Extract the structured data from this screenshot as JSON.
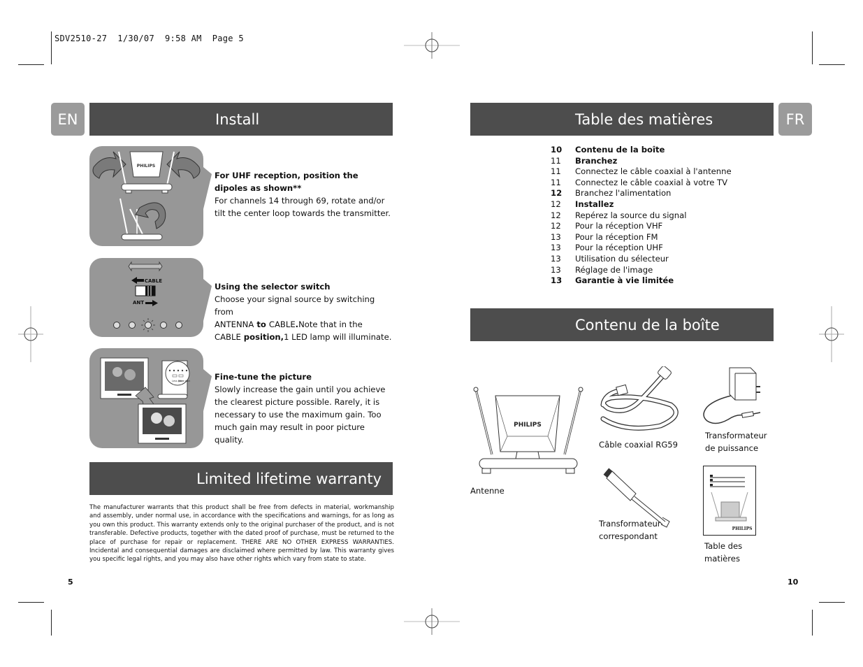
{
  "slug": "SDV2510-27  1/30/07  9:58 AM  Page 5",
  "left_page": {
    "lang_tab": "EN",
    "section_title": "Install",
    "steps": [
      {
        "title": "For UHF reception, position the dipoles as shown**",
        "body": "For channels 14 through 69, rotate and/or tilt the center loop towards the transmitter.",
        "illustration": "antenna-rotation-illustration"
      },
      {
        "title": "Using the selector switch",
        "body_parts": [
          "Choose your signal source by switching from ",
          "ANTENNA",
          " to ",
          "CABLE",
          ".",
          "Note that in the ",
          "CABLE",
          " position,",
          "1 LED lamp will illuminate."
        ],
        "illustration": "selector-switch-illustration",
        "switch_labels": {
          "cable": "CABLE",
          "ant": "ANT"
        }
      },
      {
        "title": "Fine-tune the picture",
        "body": "Slowly increase the gain until you achieve the clearest picture possible. Rarely, it is necessary to use the maximum gain. Too much gain may result in poor picture quality.",
        "illustration": "fine-tune-illustration",
        "gain_labels": {
          "less": "Less gain",
          "more": "More gain"
        }
      }
    ],
    "warranty_title": "Limited lifetime warranty",
    "warranty_text": "The manufacturer warrants that this product shall be free from defects in material, workmanship and assembly, under normal use, in accordance with the specifications and warnings, for as long as you own this product. This warranty extends only to the original purchaser of the product, and is not transferable. Defective products, together with the dated proof of purchase, must be returned to the place of purchase for repair or replacement. THERE ARE NO OTHER EXPRESS WARRANTIES.  Incidental and consequential damages are disclaimed where permitted by law.  This warranty gives you specific legal rights, and you may also have other rights which vary from state to state.",
    "page_number": "5"
  },
  "right_page": {
    "lang_tab": "FR",
    "toc_title": "Table des matières",
    "toc": [
      {
        "page": "10",
        "label": "Contenu de la boîte",
        "bold_label": true,
        "bold_num": true
      },
      {
        "page": "11",
        "label": "Branchez",
        "bold_label": true,
        "bold_num": false
      },
      {
        "page": "11",
        "label": "Connectez le câble coaxial à l'antenne",
        "bold_label": false,
        "bold_num": false
      },
      {
        "page": "11",
        "label": "Connectez le câble coaxial à votre TV",
        "bold_label": false,
        "bold_num": false
      },
      {
        "page": "12",
        "label": "Branchez l'alimentation",
        "bold_label": false,
        "bold_num": true
      },
      {
        "page": "12",
        "label": "Installez",
        "bold_label": true,
        "bold_num": false
      },
      {
        "page": "12",
        "label": "Repérez la source du signal",
        "bold_label": false,
        "bold_num": false
      },
      {
        "page": "12",
        "label": "Pour la réception VHF",
        "bold_label": false,
        "bold_num": false
      },
      {
        "page": "13",
        "label": "Pour la réception FM",
        "bold_label": false,
        "bold_num": false
      },
      {
        "page": "13",
        "label": "Pour la réception UHF",
        "bold_label": false,
        "bold_num": false
      },
      {
        "page": "13",
        "label": "Utilisation du sélecteur",
        "bold_label": false,
        "bold_num": false
      },
      {
        "page": "13",
        "label": "Réglage de l'image",
        "bold_label": false,
        "bold_num": false
      },
      {
        "page": "13",
        "label": "Garantie à vie limitée",
        "bold_label": true,
        "bold_num": true
      }
    ],
    "contents_title": "Contenu de la boîte",
    "items": {
      "antenna": "Antenne",
      "antenna_brand": "PHILIPS",
      "cable": "Câble coaxial RG59",
      "power_adapter_1": "Transformateur",
      "power_adapter_2": "de puissance",
      "matching_1": "Transformateur",
      "matching_2": "correspondant",
      "manual_1": "Table des",
      "manual_2": "matières",
      "manual_brand": "PHILIPS"
    },
    "page_number": "10"
  }
}
